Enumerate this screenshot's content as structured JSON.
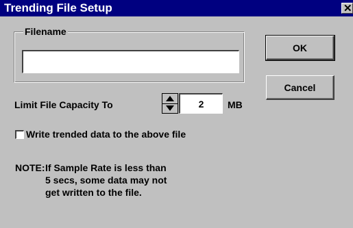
{
  "window": {
    "title": "Trending File Setup",
    "close_glyph": "✕"
  },
  "filename_group": {
    "label": "Filename",
    "value": "",
    "placeholder": ""
  },
  "buttons": {
    "ok": "OK",
    "cancel": "Cancel"
  },
  "capacity": {
    "label": "Limit File Capacity To",
    "value": "2",
    "unit": "MB"
  },
  "write_checkbox": {
    "label": "Write trended data to the above file",
    "checked": false
  },
  "note": {
    "prefix": "NOTE:",
    "text": "If Sample Rate is less than\n5 secs, some data may not\nget written to the file."
  }
}
